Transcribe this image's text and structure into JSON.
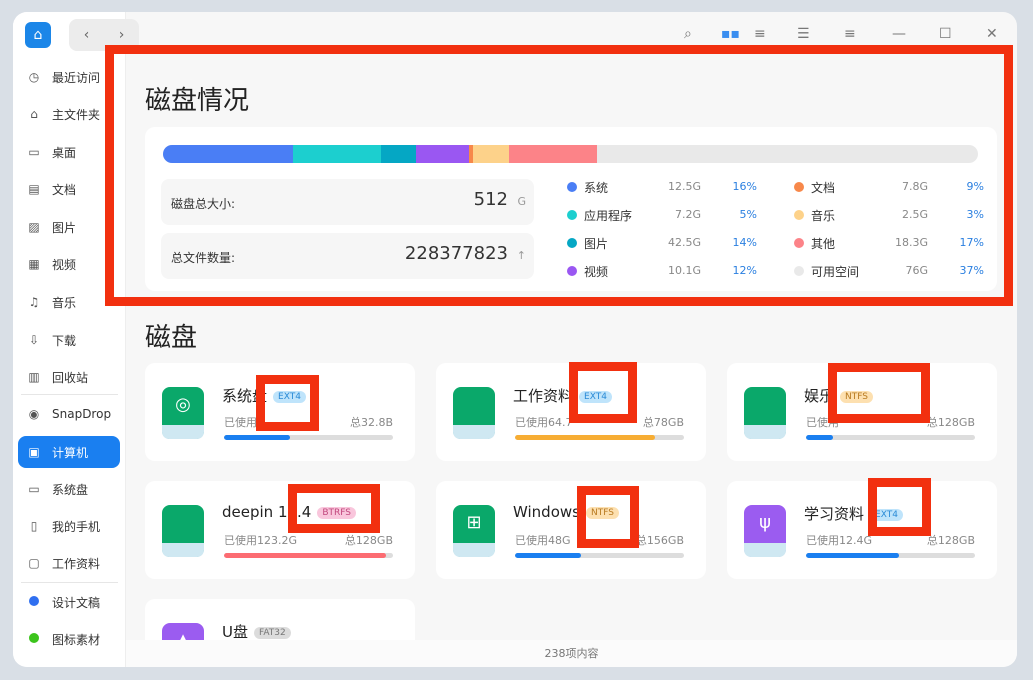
{
  "toolbar": {
    "back": "‹",
    "forward": "›",
    "icons": [
      "search-icon",
      "icon-view-icon",
      "list-view-icon",
      "tree-view-icon",
      "menu-icon",
      "minimize-icon",
      "maximize-icon",
      "close-icon"
    ]
  },
  "sidebar": {
    "items": [
      {
        "label": "最近访问",
        "icon": "◷"
      },
      {
        "label": "主文件夹",
        "icon": "⌂"
      },
      {
        "label": "桌面",
        "icon": "▭"
      },
      {
        "label": "文档",
        "icon": "▤"
      },
      {
        "label": "图片",
        "icon": "▨"
      },
      {
        "label": "视频",
        "icon": "▦"
      },
      {
        "label": "音乐",
        "icon": "♫"
      },
      {
        "label": "下载",
        "icon": "⇩"
      },
      {
        "label": "回收站",
        "icon": "▥"
      },
      {
        "label": "SnapDrop",
        "icon": "◉"
      },
      {
        "label": "计算机",
        "icon": "▣"
      },
      {
        "label": "系统盘",
        "icon": "▭"
      },
      {
        "label": "我的手机",
        "icon": "▯"
      },
      {
        "label": "工作资料",
        "icon": "▢"
      },
      {
        "label": "设计文稿",
        "color": "#2f6ff0"
      },
      {
        "label": "图标素材",
        "color": "#3cc41c"
      }
    ]
  },
  "overview": {
    "title": "磁盘情况",
    "total_label": "磁盘总大小:",
    "total_value": "512",
    "total_unit": "G",
    "files_label": "总文件数量:",
    "files_value": "228377823",
    "files_icon": "↑",
    "legend": [
      {
        "name": "系统",
        "size": "12.5G",
        "pct": "16%",
        "color": "#4a7ef5",
        "bar": 16
      },
      {
        "name": "应用程序",
        "size": "7.2G",
        "pct": "5%",
        "color": "#1ccfcf",
        "bar": 10.7
      },
      {
        "name": "图片",
        "size": "42.5G",
        "pct": "14%",
        "color": "#05a7c4",
        "bar": 4.3
      },
      {
        "name": "视频",
        "size": "10.1G",
        "pct": "12%",
        "color": "#9a57f2",
        "bar": 6.5
      },
      {
        "name": "文档",
        "size": "7.8G",
        "pct": "9%",
        "color": "#f7884a",
        "bar": 0.6
      },
      {
        "name": "音乐",
        "size": "2.5G",
        "pct": "3%",
        "color": "#fdd28a",
        "bar": 4.4
      },
      {
        "name": "其他",
        "size": "18.3G",
        "pct": "17%",
        "color": "#fc8388",
        "bar": 10.8
      },
      {
        "name": "可用空间",
        "size": "76G",
        "pct": "37%",
        "color": "#e9e9e9",
        "bar": 0
      }
    ]
  },
  "disks": {
    "title": "磁盘",
    "items": [
      {
        "name": "系统盘",
        "fs": "EXT4",
        "fs_bg": "#bfe4fb",
        "fs_color": "#2a8ad6",
        "used": "已使用",
        "total": "总32.8B",
        "fill": 0.39,
        "bar_color": "#1a7ff0",
        "icon": "deepin-logo-icon",
        "glyph": "◎",
        "drive_color": "#0aa86a"
      },
      {
        "name": "工作资料",
        "fs": "EXT4",
        "fs_bg": "#bfe4fb",
        "fs_color": "#2a8ad6",
        "used": "已使用64.7",
        "total": "总78GB",
        "fill": 0.83,
        "bar_color": "#f7ad33",
        "icon": "drive-icon",
        "glyph": "",
        "drive_color": "#0aa86a"
      },
      {
        "name": "娱乐",
        "fs": "NTFS",
        "fs_bg": "#fde0b0",
        "fs_color": "#b87a20",
        "used": "已使用",
        "total": "总128GB",
        "fill": 0.16,
        "bar_color": "#1a7ff0",
        "icon": "drive-icon",
        "glyph": "",
        "drive_color": "#0aa86a"
      },
      {
        "name": "deepin 15.4",
        "fs": "BTRFS",
        "fs_bg": "#f9c6dc",
        "fs_color": "#c1477d",
        "used": "已使用123.2G",
        "total": "总128GB",
        "fill": 0.96,
        "bar_color": "#fc6c72",
        "icon": "drive-icon",
        "glyph": "",
        "drive_color": "#0aa86a"
      },
      {
        "name": "Windows",
        "fs": "NTFS",
        "fs_bg": "#fde0b0",
        "fs_color": "#b87a20",
        "used": "已使用48G",
        "total": "总156GB",
        "fill": 0.39,
        "bar_color": "#1a7ff0",
        "icon": "windows-logo-icon",
        "glyph": "⊞",
        "drive_color": "#0aa86a"
      },
      {
        "name": "学习资料",
        "fs": "EXT4",
        "fs_bg": "#bfe4fb",
        "fs_color": "#2a8ad6",
        "used": "已使用12.4G",
        "total": "总128GB",
        "fill": 0.55,
        "bar_color": "#1a7ff0",
        "icon": "usb-icon",
        "glyph": "ψ",
        "drive_color": "#9b5cf0"
      },
      {
        "name": "U盘",
        "fs": "FAT32",
        "fs_bg": "#dcdcdc",
        "fs_color": "#777",
        "used": "",
        "total": "",
        "fill": 0,
        "bar_color": "#1a7ff0",
        "icon": "usb-drive-icon",
        "glyph": "▲",
        "drive_color": "#9b5cf0"
      }
    ]
  },
  "status": {
    "count": "238项内容"
  }
}
